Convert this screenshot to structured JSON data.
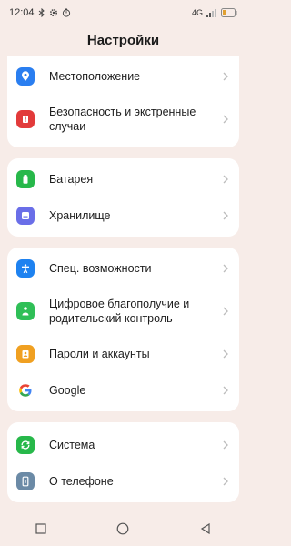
{
  "status": {
    "time": "12:04",
    "network": "4G",
    "left_icons": [
      "bluetooth-icon",
      "gear-icon",
      "timer-icon"
    ],
    "right_icons": [
      "signal-icon",
      "battery-icon"
    ]
  },
  "header": {
    "title": "Настройки"
  },
  "groups": [
    {
      "items": [
        {
          "label": "Местоположение",
          "icon": "location-pin-icon",
          "color": "#2a7ef0"
        },
        {
          "label": "Безопасность и экстренные случаи",
          "icon": "emergency-icon",
          "color": "#e23a3a"
        }
      ]
    },
    {
      "items": [
        {
          "label": "Батарея",
          "icon": "battery-icon",
          "color": "#27b84a"
        },
        {
          "label": "Хранилище",
          "icon": "storage-icon",
          "color": "#6a6ee8"
        }
      ]
    },
    {
      "items": [
        {
          "label": "Спец. возможности",
          "icon": "accessibility-icon",
          "color": "#1e82f0"
        },
        {
          "label": "Цифровое благополучие и родительский контроль",
          "icon": "wellbeing-icon",
          "color": "#2fbf57"
        },
        {
          "label": "Пароли и аккаунты",
          "icon": "account-icon",
          "color": "#f0a021"
        },
        {
          "label": "Google",
          "icon": "google-icon",
          "color": "#4285f4"
        }
      ]
    },
    {
      "items": [
        {
          "label": "Система",
          "icon": "system-update-icon",
          "color": "#27b84a"
        },
        {
          "label": "О телефоне",
          "icon": "phone-info-icon",
          "color": "#6b8aa6"
        }
      ]
    }
  ],
  "nav": [
    "recents-square-icon",
    "home-circle-icon",
    "back-triangle-icon"
  ]
}
